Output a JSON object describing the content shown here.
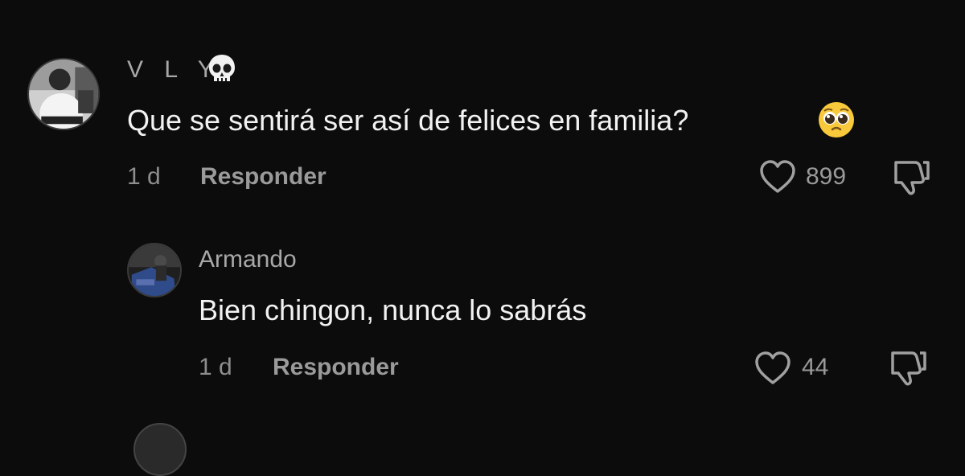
{
  "comments": [
    {
      "username": "V L Y",
      "username_icon": "skull-emoji",
      "text": "Que se sentirá ser así de felices en familia?",
      "text_emoji": "pleading-face-emoji",
      "time": "1 d",
      "reply_label": "Responder",
      "likes": "899"
    },
    {
      "username": "Armando",
      "text": "Bien chingon, nunca lo sabrás",
      "time": "1 d",
      "reply_label": "Responder",
      "likes": "44"
    }
  ],
  "icons": {
    "like": "heart-outline-icon",
    "dislike": "thumbs-down-outline-icon"
  },
  "colors": {
    "background": "#0c0c0c",
    "primary_text": "#f2f2f2",
    "secondary_text": "#8e8e8e"
  }
}
